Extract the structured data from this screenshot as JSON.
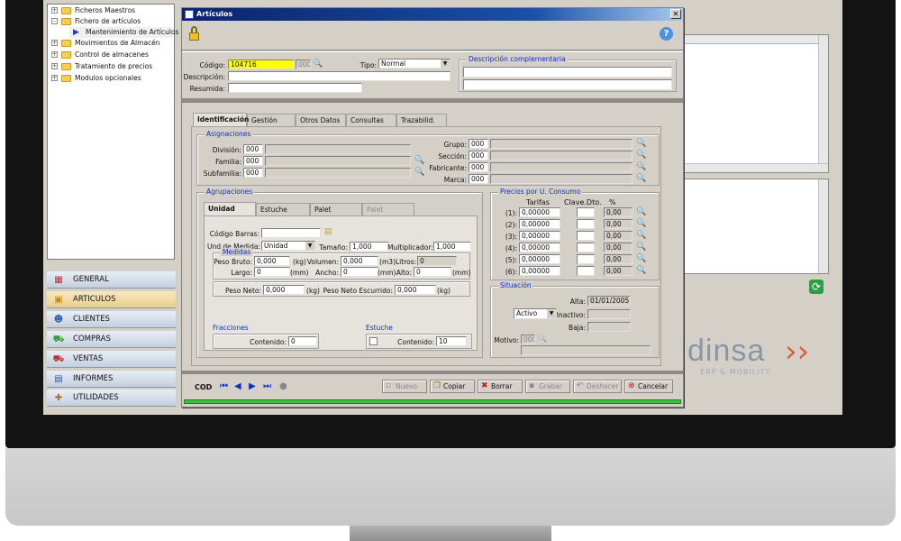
{
  "tree": {
    "items": [
      {
        "label": "Ficheros Maestros",
        "exp": "+"
      },
      {
        "label": "Fichero de artículos",
        "exp": "-"
      },
      {
        "label": "Mantenimiento de Artículos"
      },
      {
        "label": "Movimientos de Almacén",
        "exp": "+"
      },
      {
        "label": "Control de almacenes",
        "exp": "+"
      },
      {
        "label": "Tratamiento de precios",
        "exp": "+"
      },
      {
        "label": "Modulos opcionales",
        "exp": "+"
      }
    ]
  },
  "nav": [
    {
      "label": "GENERAL",
      "icon": "general-icon",
      "glyph": "▦"
    },
    {
      "label": "ARTICULOS",
      "icon": "box-icon",
      "glyph": "▣"
    },
    {
      "label": "CLIENTES",
      "icon": "users-icon",
      "glyph": "☻"
    },
    {
      "label": "COMPRAS",
      "icon": "cart-icon",
      "glyph": "⛟"
    },
    {
      "label": "VENTAS",
      "icon": "truck-icon",
      "glyph": "⛟"
    },
    {
      "label": "INFORMES",
      "icon": "report-icon",
      "glyph": "▤"
    },
    {
      "label": "UTILIDADES",
      "icon": "tools-icon",
      "glyph": "✚"
    }
  ],
  "dialog": {
    "title": "Artículos",
    "codigo_label": "Código:",
    "codigo_value": "104716",
    "codigo_suffix": "000",
    "tipo_label": "Tipo:",
    "tipo_value": "Normal",
    "descripcion_label": "Descripción:",
    "resumida_label": "Resumida:",
    "desc_comp_title": "Descripción complementaria",
    "tabs": [
      "Identificación",
      "Gestión",
      "Otros Datos",
      "Consultas",
      "Trazabilid."
    ],
    "asignaciones": {
      "title": "Asignaciones",
      "left": [
        {
          "label": "División:",
          "value": "000"
        },
        {
          "label": "Familia:",
          "value": "000"
        },
        {
          "label": "Subfamilia:",
          "value": "000"
        }
      ],
      "right": [
        {
          "label": "Grupo:",
          "value": "000"
        },
        {
          "label": "Sección:",
          "value": "000"
        },
        {
          "label": "Fabricante:",
          "value": "000"
        },
        {
          "label": "Marca:",
          "value": "000"
        }
      ]
    },
    "agrupaciones": {
      "title": "Agrupaciones",
      "tabs": [
        "Unidad",
        "Estuche",
        "Palet",
        "Palet"
      ],
      "codigo_barras_label": "Código Barras:",
      "und_medida_label": "Und.de Medida:",
      "und_medida_value": "Unidad",
      "tamano_label": "Tamaño:",
      "tamano_value": "1,000",
      "multiplicador_label": "Multiplicador:",
      "multiplicador_value": "1,000",
      "medidas_title": "Medidas",
      "peso_bruto_label": "Peso Bruto:",
      "peso_bruto_value": "0,000",
      "unit_kg": "(kg)",
      "volumen_label": "Volumen:",
      "volumen_value": "0,000",
      "unit_m3": "(m3)",
      "litros_label": "Litros:",
      "litros_value": "0",
      "largo_label": "Largo:",
      "largo_value": "0",
      "unit_mm": "(mm)",
      "ancho_label": "Ancho:",
      "ancho_value": "0",
      "alto_label": "Alto:",
      "alto_value": "0",
      "peso_neto_label": "Peso Neto:",
      "peso_neto_value": "0,000",
      "peso_neto_esc_label": "Peso Neto Escurrido:",
      "peso_neto_esc_value": "0,000",
      "fracciones_title": "Fracciones",
      "estuche_title": "Estuche",
      "contenido_label": "Contenido:",
      "fracciones_contenido": "0",
      "estuche_contenido": "10"
    },
    "precios": {
      "title": "Precios por U. Consumo",
      "col_tarifas": "Tarifas",
      "col_clave": "Clave.Dto.",
      "col_pct": "%",
      "rows": [
        {
          "label": "(1):",
          "tarifa": "0,00000",
          "pct": "0,00"
        },
        {
          "label": "(2):",
          "tarifa": "0,00000",
          "pct": "0,00"
        },
        {
          "label": "(3):",
          "tarifa": "0,00000",
          "pct": "0,00"
        },
        {
          "label": "(4):",
          "tarifa": "0,00000",
          "pct": "0,00"
        },
        {
          "label": "(5):",
          "tarifa": "0,00000",
          "pct": "0,00"
        },
        {
          "label": "(6):",
          "tarifa": "0,00000",
          "pct": "0,00"
        }
      ]
    },
    "situacion": {
      "title": "Situación",
      "alta_label": "Alta:",
      "alta_value": "01/01/2005",
      "estado_value": "Activo",
      "inactivo_label": "Inactivo:",
      "baja_label": "Baja:",
      "motivo_label": "Motivo:",
      "motivo_value": "000"
    },
    "footer": {
      "cod_label": "COD",
      "buttons": [
        {
          "label": "Nuevo",
          "enabled": false,
          "icon": "new-icon",
          "glyph": "▫"
        },
        {
          "label": "Copiar",
          "enabled": true,
          "icon": "copy-icon",
          "glyph": "❐"
        },
        {
          "label": "Borrar",
          "enabled": true,
          "icon": "delete-icon",
          "glyph": "✖"
        },
        {
          "label": "Grabar",
          "enabled": false,
          "icon": "save-icon",
          "glyph": "▪"
        },
        {
          "label": "Deshacer",
          "enabled": false,
          "icon": "undo-icon",
          "glyph": "↶"
        },
        {
          "label": "Cancelar",
          "enabled": true,
          "icon": "cancel-icon",
          "glyph": "⊗"
        }
      ]
    }
  },
  "brand": {
    "name": "dinsa",
    "tagline": "ERP & MOBILITY"
  },
  "colors": {
    "title_bar": "#0a246a",
    "group_title": "#1030c0",
    "code_highlight": "#ffff00",
    "status_bar": "#40c040"
  }
}
